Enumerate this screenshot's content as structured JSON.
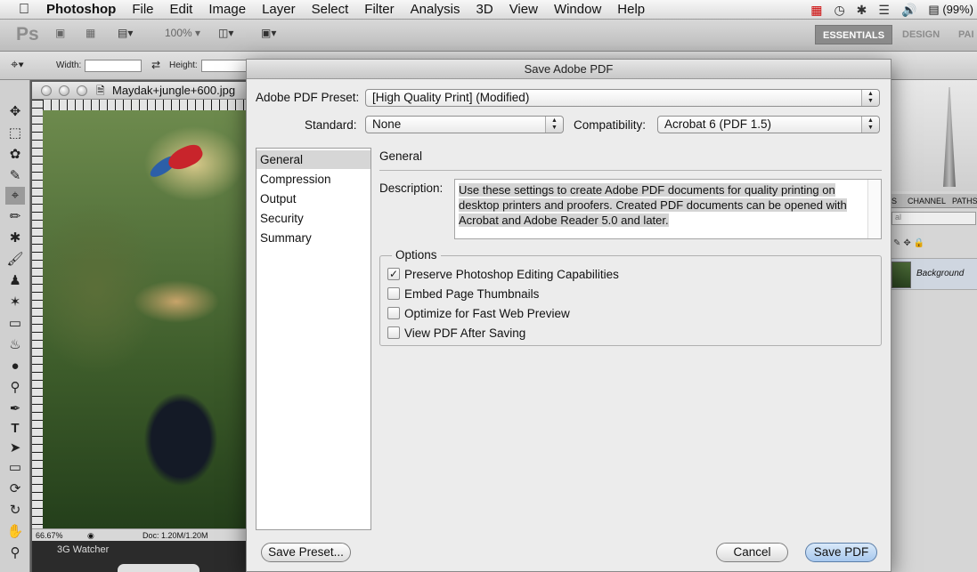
{
  "menubar": {
    "app_name": "Photoshop",
    "items": [
      "File",
      "Edit",
      "Image",
      "Layer",
      "Select",
      "Filter",
      "Analysis",
      "3D",
      "View",
      "Window",
      "Help"
    ],
    "battery": "(99%)"
  },
  "appbar": {
    "logo": "Ps",
    "zoom": "100%",
    "workspaces": [
      "ESSENTIALS",
      "DESIGN",
      "PAI"
    ]
  },
  "optbar": {
    "width_label": "Width:",
    "height_label": "Height:"
  },
  "document": {
    "title": "Maydak+jungle+600.jpg",
    "zoom": "66.67%",
    "doc_info": "Doc: 1.20M/1.20M",
    "watcher_label": "3G Watcher"
  },
  "panels": {
    "tabs": [
      "S",
      "CHANNEL",
      "PATHS"
    ],
    "blend_mode": "al",
    "layer_name": "Background"
  },
  "dialog": {
    "title": "Save Adobe PDF",
    "preset_label": "Adobe PDF Preset:",
    "preset_value": "[High Quality Print] (Modified)",
    "standard_label": "Standard:",
    "standard_value": "None",
    "compat_label": "Compatibility:",
    "compat_value": "Acrobat 6 (PDF 1.5)",
    "sidebar": [
      "General",
      "Compression",
      "Output",
      "Security",
      "Summary"
    ],
    "selected_section": "General",
    "section_title": "General",
    "description_label": "Description:",
    "description": "Use these settings to create Adobe PDF documents for quality printing on desktop printers and proofers.  Created PDF documents can be opened with Acrobat and Adobe Reader 5.0 and later.",
    "options_label": "Options",
    "options": [
      {
        "label": "Preserve Photoshop Editing Capabilities",
        "checked": true
      },
      {
        "label": "Embed Page Thumbnails",
        "checked": false
      },
      {
        "label": "Optimize for Fast Web Preview",
        "checked": false
      },
      {
        "label": "View PDF After Saving",
        "checked": false
      }
    ],
    "save_preset_label": "Save Preset...",
    "cancel_label": "Cancel",
    "save_pdf_label": "Save PDF"
  }
}
